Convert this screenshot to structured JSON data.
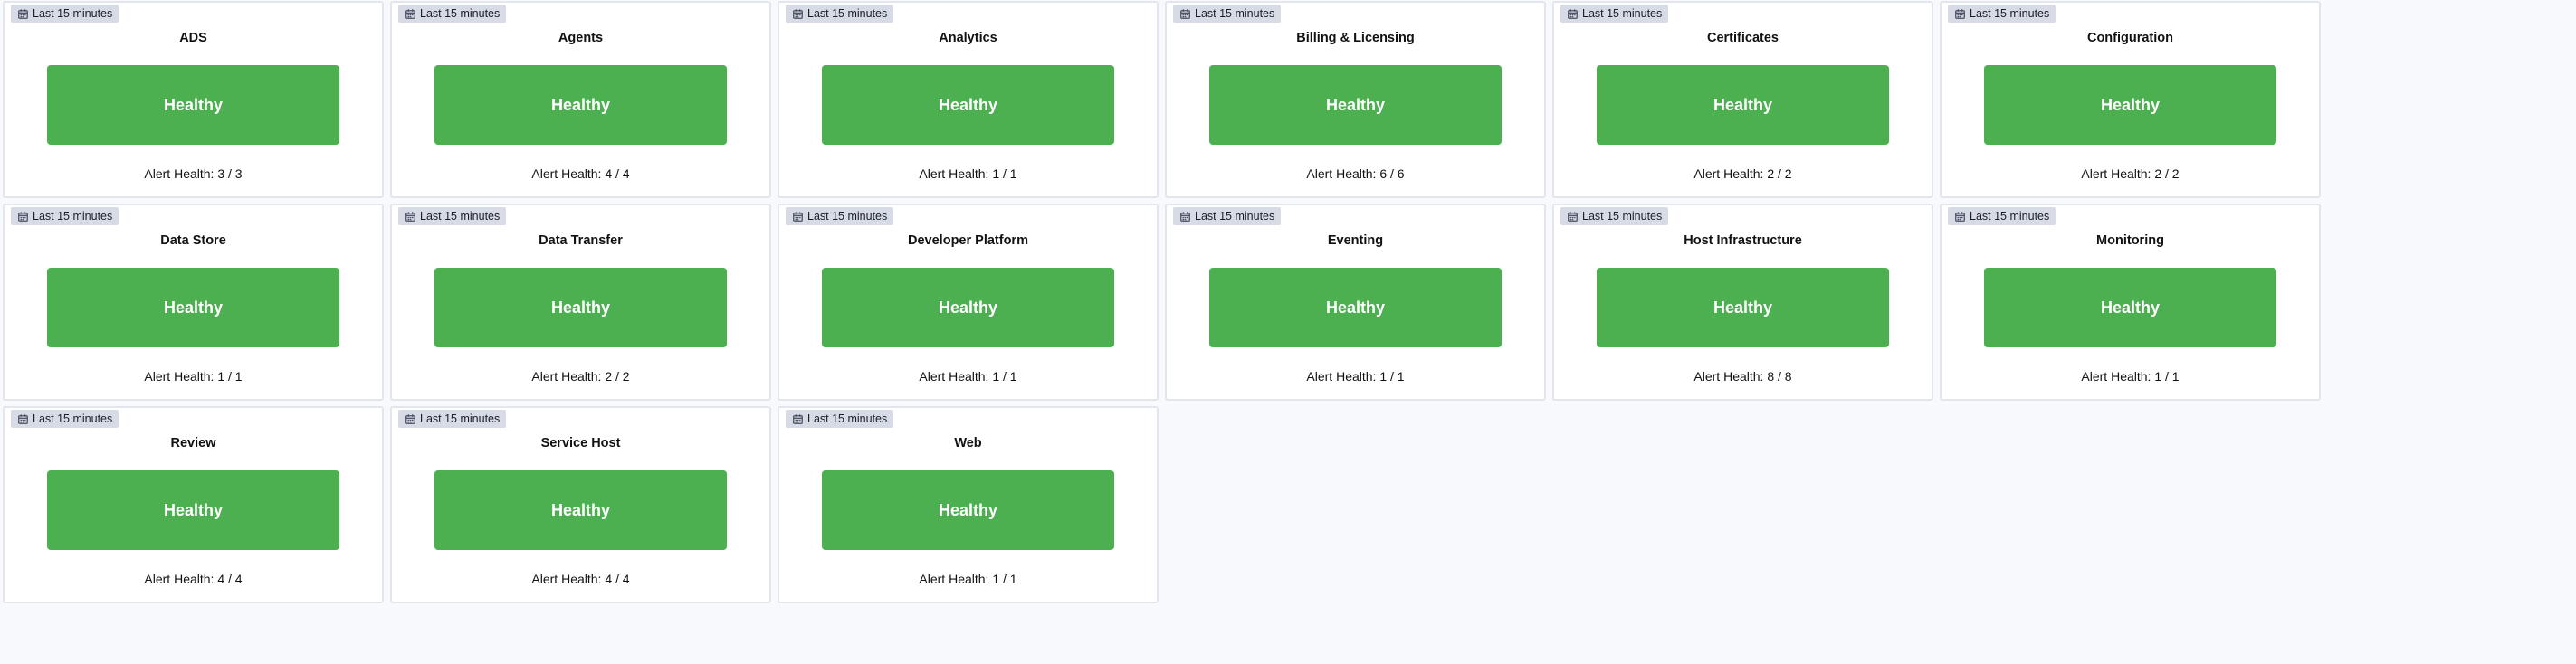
{
  "badge_label": "Last 15 minutes",
  "status_color": "#4caf50",
  "cards": [
    {
      "title": "ADS",
      "status": "Healthy",
      "alert_health": "Alert Health: 3 / 3"
    },
    {
      "title": "Agents",
      "status": "Healthy",
      "alert_health": "Alert Health: 4 / 4"
    },
    {
      "title": "Analytics",
      "status": "Healthy",
      "alert_health": "Alert Health: 1 / 1"
    },
    {
      "title": "Billing & Licensing",
      "status": "Healthy",
      "alert_health": "Alert Health: 6 / 6"
    },
    {
      "title": "Certificates",
      "status": "Healthy",
      "alert_health": "Alert Health: 2 / 2"
    },
    {
      "title": "Configuration",
      "status": "Healthy",
      "alert_health": "Alert Health: 2 / 2"
    },
    {
      "title": "Data Store",
      "status": "Healthy",
      "alert_health": "Alert Health: 1 / 1"
    },
    {
      "title": "Data Transfer",
      "status": "Healthy",
      "alert_health": "Alert Health: 2 / 2"
    },
    {
      "title": "Developer Platform",
      "status": "Healthy",
      "alert_health": "Alert Health: 1 / 1"
    },
    {
      "title": "Eventing",
      "status": "Healthy",
      "alert_health": "Alert Health: 1 / 1"
    },
    {
      "title": "Host Infrastructure",
      "status": "Healthy",
      "alert_health": "Alert Health: 8 / 8"
    },
    {
      "title": "Monitoring",
      "status": "Healthy",
      "alert_health": "Alert Health: 1 / 1"
    },
    {
      "title": "Review",
      "status": "Healthy",
      "alert_health": "Alert Health: 4 / 4"
    },
    {
      "title": "Service Host",
      "status": "Healthy",
      "alert_health": "Alert Health: 4 / 4"
    },
    {
      "title": "Web",
      "status": "Healthy",
      "alert_health": "Alert Health: 1 / 1"
    }
  ]
}
